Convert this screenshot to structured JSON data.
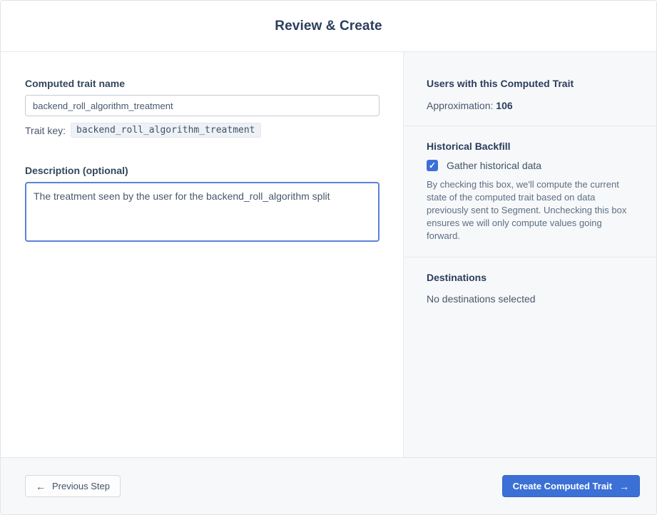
{
  "header": {
    "title": "Review & Create"
  },
  "form": {
    "name_label": "Computed trait name",
    "name_value": "backend_roll_algorithm_treatment",
    "trait_key_label": "Trait key:",
    "trait_key_value": "backend_roll_algorithm_treatment",
    "description_label": "Description (optional)",
    "description_value": "The treatment seen by the user for the backend_roll_algorithm split"
  },
  "summary": {
    "users_heading": "Users with this Computed Trait",
    "approximation_label": "Approximation:",
    "approximation_value": "106",
    "backfill_heading": "Historical Backfill",
    "backfill_checkbox_label": "Gather historical data",
    "backfill_checkbox_checked": true,
    "backfill_description": "By checking this box, we'll compute the current state of the computed trait based on data previously sent to Segment. Unchecking this box ensures we will only compute values going forward.",
    "destinations_heading": "Destinations",
    "destinations_empty": "No destinations selected"
  },
  "footer": {
    "previous_label": "Previous Step",
    "create_label": "Create Computed Trait"
  },
  "icons": {
    "arrow_left": "←",
    "arrow_right": "→",
    "checkmark": "✓"
  },
  "colors": {
    "primary_blue": "#3b70d6",
    "heading_navy": "#2b3e5c",
    "body_slate": "#47586d",
    "muted_slate": "#5d6f83",
    "panel_bg": "#f7f8fa",
    "divider": "#e4e7eb",
    "input_border": "#c3ccd6",
    "focus_border": "#5c82d8"
  }
}
